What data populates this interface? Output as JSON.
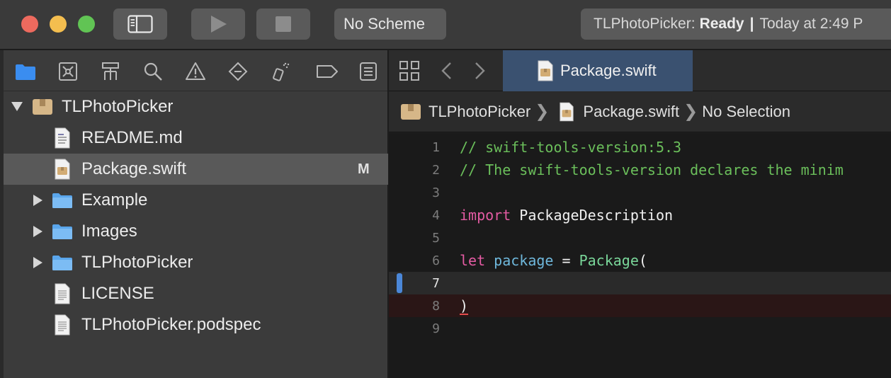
{
  "toolbar": {
    "scheme_label": "No Scheme",
    "status_project": "TLPhotoPicker:",
    "status_state": "Ready",
    "status_separator": "|",
    "status_time": "Today at 2:49 P"
  },
  "navigator": {
    "tabs": [
      "folder-icon",
      "source-control-icon",
      "symbol-hierarchy-icon",
      "search-icon",
      "warning-icon",
      "breakpoint-diamond-icon",
      "test-spray-icon",
      "tag-icon",
      "report-list-icon"
    ],
    "files": [
      {
        "label": "TLPhotoPicker",
        "type": "package",
        "expanded": true,
        "indent": 0
      },
      {
        "label": "README.md",
        "type": "markdown-file",
        "indent": 1
      },
      {
        "label": "Package.swift",
        "type": "swift-package-file",
        "indent": 1,
        "selected": true,
        "badge": "M"
      },
      {
        "label": "Example",
        "type": "folder",
        "expanded": false,
        "indent": 1
      },
      {
        "label": "Images",
        "type": "folder",
        "expanded": false,
        "indent": 1
      },
      {
        "label": "TLPhotoPicker",
        "type": "folder",
        "expanded": false,
        "indent": 1
      },
      {
        "label": "LICENSE",
        "type": "text-file",
        "indent": 1
      },
      {
        "label": "TLPhotoPicker.podspec",
        "type": "text-file",
        "indent": 1
      }
    ]
  },
  "editor": {
    "active_tab": "Package.swift",
    "jump_bar": {
      "project": "TLPhotoPicker",
      "file": "Package.swift",
      "selection": "No Selection"
    },
    "lines": [
      {
        "number": "1",
        "text": "// swift-tools-version:5.3"
      },
      {
        "number": "2",
        "text": "// The swift-tools-version declares the minim"
      },
      {
        "number": "3",
        "text": ""
      },
      {
        "number": "4",
        "keyword": "import",
        "rest": " PackageDescription"
      },
      {
        "number": "5",
        "text": ""
      },
      {
        "number": "6",
        "keyword": "let",
        "ident": "package",
        "op": " = ",
        "type": "Package",
        "paren": "("
      },
      {
        "number": "7",
        "text": ""
      },
      {
        "number": "8",
        "text": ")"
      },
      {
        "number": "9",
        "text": ""
      }
    ]
  },
  "colors": {
    "selected_tab": "#3a5170",
    "comment": "#6bbf5b",
    "keyword": "#e45ba3",
    "identifier": "#6fb8dc",
    "type": "#7ad79a",
    "change_indicator": "#4b87d8"
  }
}
